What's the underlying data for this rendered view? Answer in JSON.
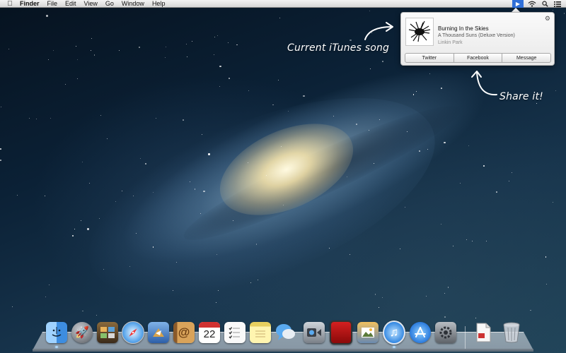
{
  "menubar": {
    "app_name": "Finder",
    "menus": [
      "File",
      "Edit",
      "View",
      "Go",
      "Window",
      "Help"
    ],
    "status_icons": [
      "share-icon",
      "wifi-icon",
      "spotlight-icon",
      "notification-center-icon"
    ]
  },
  "share_popover": {
    "track_title": "Burning In the Skies",
    "album": "A Thousand Suns (Deluxe Version)",
    "artist": "Linkin Park",
    "buttons": [
      "Twitter",
      "Facebook",
      "Message"
    ]
  },
  "annotations": {
    "current_song": "Current iTunes song",
    "share_it": "Share it!"
  },
  "dock": {
    "calendar_day": "22",
    "items": [
      "finder-icon",
      "launchpad-icon",
      "mission-control-icon",
      "safari-icon",
      "mail-icon",
      "contacts-icon",
      "calendar-icon",
      "reminders-icon",
      "notes-icon",
      "messages-icon",
      "facetime-icon",
      "photo-booth-icon",
      "iphoto-icon",
      "itunes-icon",
      "app-store-icon",
      "system-preferences-icon",
      "documents-icon",
      "trash-icon"
    ]
  },
  "colors": {
    "status_accent": "#2f6fd8",
    "indicator": "#9cd6ff"
  }
}
